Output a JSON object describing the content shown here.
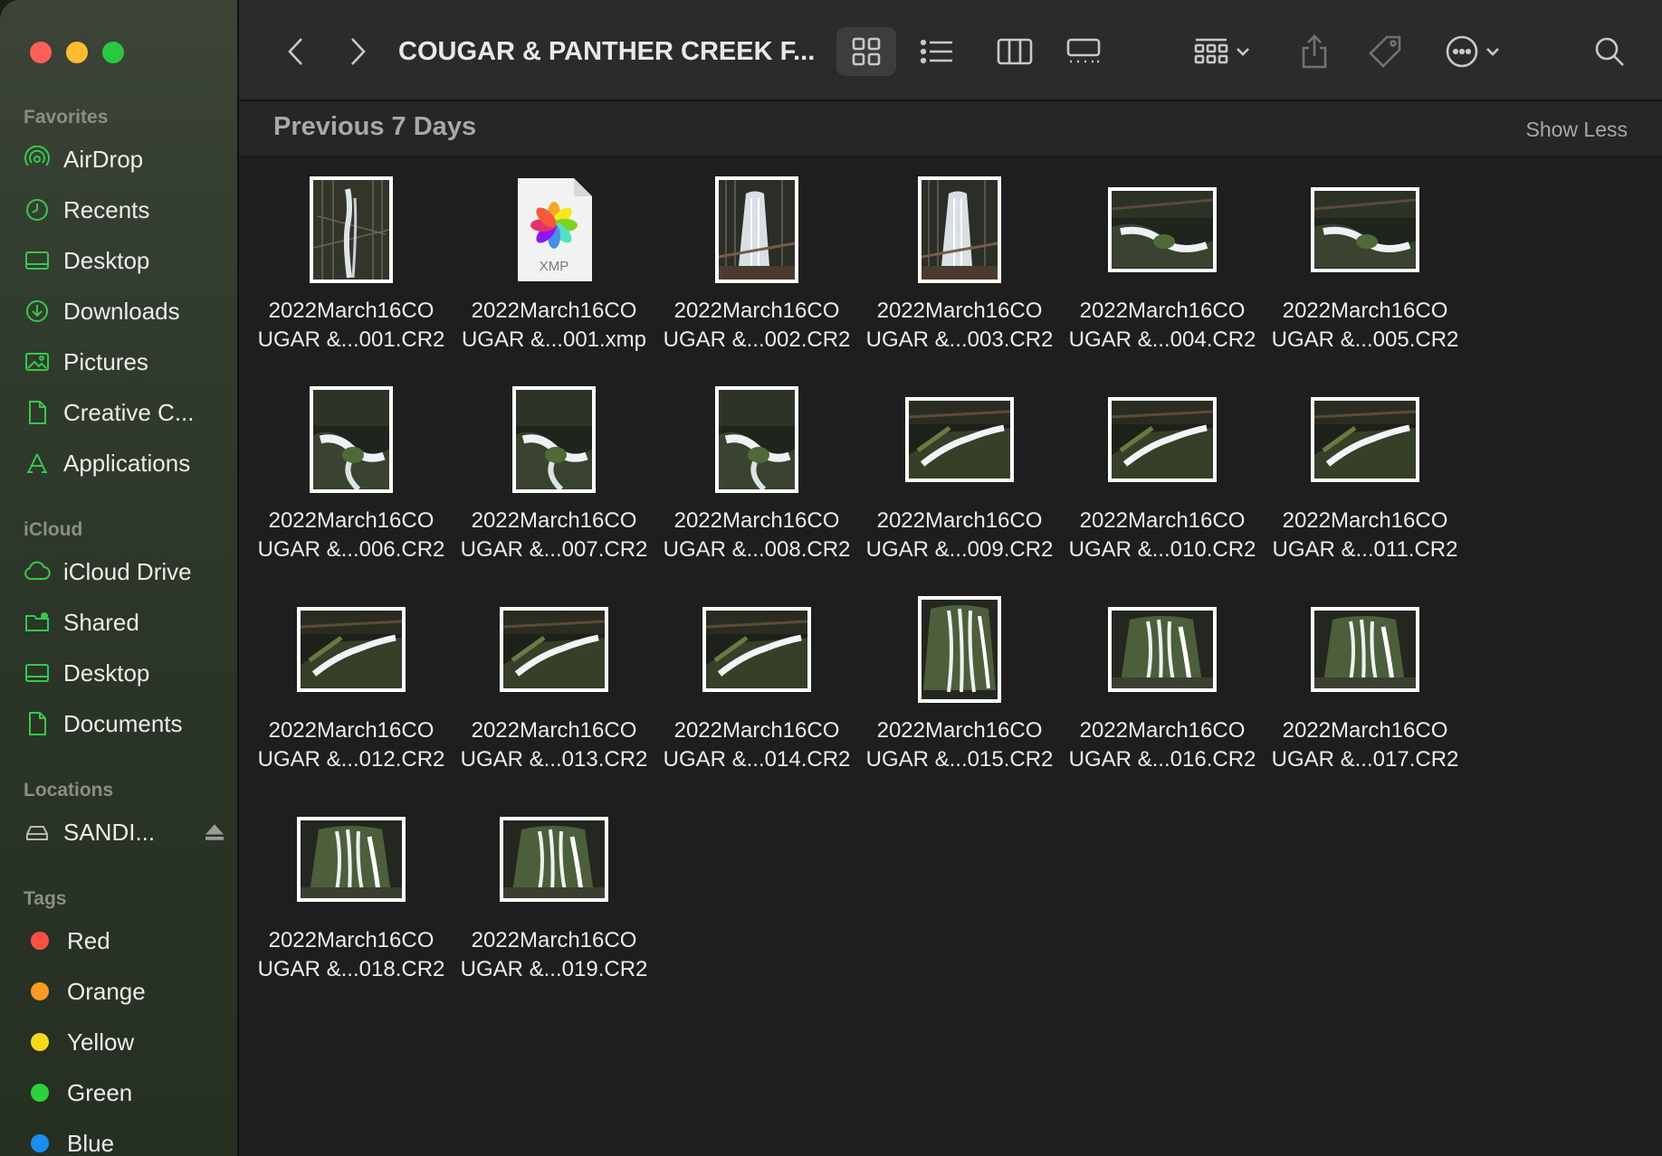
{
  "window": {
    "title": "COUGAR & PANTHER CREEK F...",
    "traffic": [
      "close",
      "minimize",
      "zoom"
    ]
  },
  "sidebar": {
    "sections": [
      {
        "label": "Favorites",
        "items": [
          {
            "label": "AirDrop",
            "icon": "airdrop-icon"
          },
          {
            "label": "Recents",
            "icon": "clock-icon"
          },
          {
            "label": "Desktop",
            "icon": "desktop-icon"
          },
          {
            "label": "Downloads",
            "icon": "download-icon"
          },
          {
            "label": "Pictures",
            "icon": "photo-icon"
          },
          {
            "label": "Creative C...",
            "icon": "document-icon"
          },
          {
            "label": "Applications",
            "icon": "applications-icon"
          }
        ]
      },
      {
        "label": "iCloud",
        "items": [
          {
            "label": "iCloud Drive",
            "icon": "cloud-icon"
          },
          {
            "label": "Shared",
            "icon": "shared-folder-icon"
          },
          {
            "label": "Desktop",
            "icon": "desktop-icon"
          },
          {
            "label": "Documents",
            "icon": "document-icon"
          }
        ]
      },
      {
        "label": "Locations",
        "items": [
          {
            "label": "SANDI...",
            "icon": "drive-icon"
          }
        ]
      },
      {
        "label": "Tags",
        "items": [
          {
            "label": "Red",
            "color": "#fe4f44"
          },
          {
            "label": "Orange",
            "color": "#f99b22"
          },
          {
            "label": "Yellow",
            "color": "#f8d81b"
          },
          {
            "label": "Green",
            "color": "#2bd23c"
          },
          {
            "label": "Blue",
            "color": "#1b8ef5"
          }
        ]
      }
    ]
  },
  "group": {
    "title": "Previous 7 Days",
    "action": "Show Less"
  },
  "files": [
    {
      "line1": "2022March16CO",
      "line2": "UGAR &...001.CR2",
      "orientation": "portrait",
      "scene": "tall-falls"
    },
    {
      "line1": "2022March16CO",
      "line2": "UGAR &...001.xmp",
      "orientation": "xmp",
      "badge": "XMP"
    },
    {
      "line1": "2022March16CO",
      "line2": "UGAR &...002.CR2",
      "orientation": "portrait",
      "scene": "falls"
    },
    {
      "line1": "2022March16CO",
      "line2": "UGAR &...003.CR2",
      "orientation": "portrait",
      "scene": "falls"
    },
    {
      "line1": "2022March16CO",
      "line2": "UGAR &...004.CR2",
      "orientation": "landscape",
      "scene": "creek"
    },
    {
      "line1": "2022March16CO",
      "line2": "UGAR &...005.CR2",
      "orientation": "landscape",
      "scene": "creek"
    },
    {
      "line1": "2022March16CO",
      "line2": "UGAR &...006.CR2",
      "orientation": "portrait",
      "scene": "creek"
    },
    {
      "line1": "2022March16CO",
      "line2": "UGAR &...007.CR2",
      "orientation": "portrait",
      "scene": "creek"
    },
    {
      "line1": "2022March16CO",
      "line2": "UGAR &...008.CR2",
      "orientation": "portrait",
      "scene": "creek"
    },
    {
      "line1": "2022March16CO",
      "line2": "UGAR &...009.CR2",
      "orientation": "landscape",
      "scene": "cascade"
    },
    {
      "line1": "2022March16CO",
      "line2": "UGAR &...010.CR2",
      "orientation": "landscape",
      "scene": "cascade"
    },
    {
      "line1": "2022March16CO",
      "line2": "UGAR &...011.CR2",
      "orientation": "landscape",
      "scene": "cascade"
    },
    {
      "line1": "2022March16CO",
      "line2": "UGAR &...012.CR2",
      "orientation": "landscape",
      "scene": "cascade"
    },
    {
      "line1": "2022March16CO",
      "line2": "UGAR &...013.CR2",
      "orientation": "landscape",
      "scene": "cascade"
    },
    {
      "line1": "2022March16CO",
      "line2": "UGAR &...014.CR2",
      "orientation": "landscape",
      "scene": "cascade"
    },
    {
      "line1": "2022March16CO",
      "line2": "UGAR &...015.CR2",
      "orientation": "portrait",
      "scene": "panther"
    },
    {
      "line1": "2022March16CO",
      "line2": "UGAR &...016.CR2",
      "orientation": "landscape",
      "scene": "panther"
    },
    {
      "line1": "2022March16CO",
      "line2": "UGAR &...017.CR2",
      "orientation": "landscape",
      "scene": "panther"
    },
    {
      "line1": "2022March16CO",
      "line2": "UGAR &...018.CR2",
      "orientation": "landscape",
      "scene": "panther"
    },
    {
      "line1": "2022March16CO",
      "line2": "UGAR &...019.CR2",
      "orientation": "landscape",
      "scene": "panther"
    }
  ]
}
